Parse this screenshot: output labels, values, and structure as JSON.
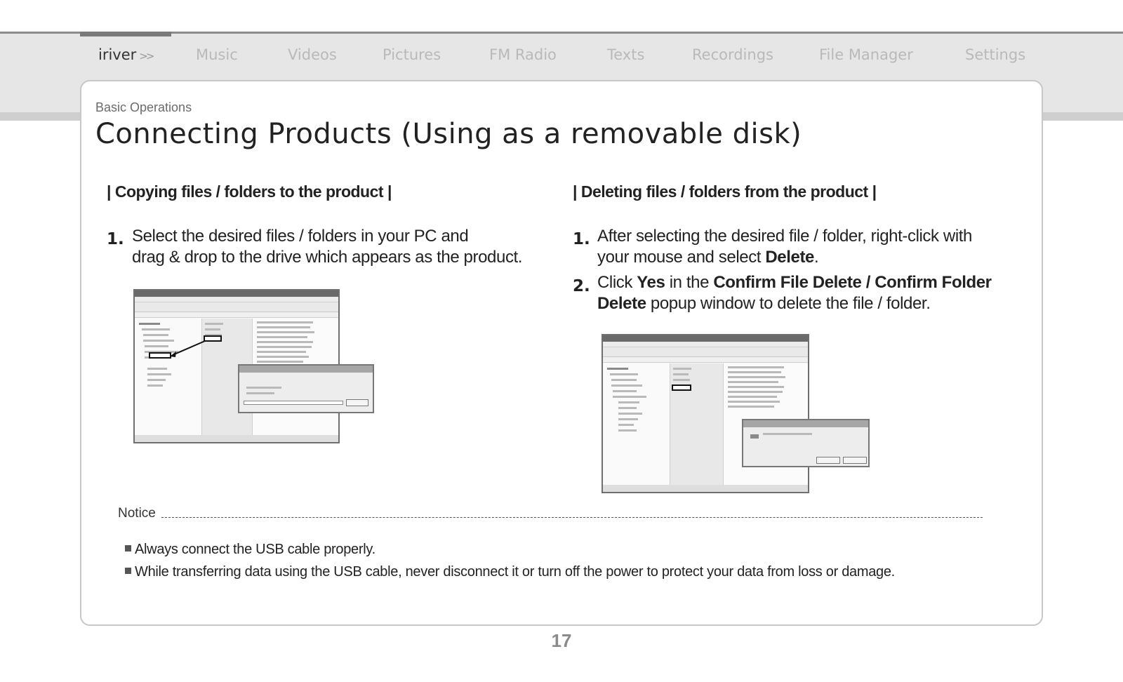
{
  "nav": {
    "brand": "iriver",
    "items": [
      "Music",
      "Videos",
      "Pictures",
      "FM Radio",
      "Texts",
      "Recordings",
      "File Manager",
      "Settings"
    ]
  },
  "breadcrumb": "Basic Operations",
  "title": "Connecting Products (Using as a removable disk)",
  "copy_section": {
    "heading": "Copying files / folders to the product",
    "steps": [
      {
        "num": "1.",
        "lines": [
          "Select the desired files / folders in your PC and",
          "drag & drop to the drive which appears as the product."
        ]
      }
    ]
  },
  "delete_section": {
    "heading": "Deleting files / folders from the product",
    "step1": {
      "num": "1.",
      "line1": "After selecting the desired file / folder, right-click with",
      "line2_prefix": "your mouse and select ",
      "line2_bold": "Delete",
      "line2_suffix": "."
    },
    "step2": {
      "num": "2.",
      "prefix": "Click ",
      "bold_yes": "Yes",
      "mid": " in the ",
      "bold_confirm": "Confirm File Delete / Confirm Folder",
      "bold_delete": "Delete",
      "suffix": " popup window to delete the file / folder."
    }
  },
  "notice": {
    "label": "Notice",
    "items": [
      "Always connect the USB cable properly.",
      "While transferring data using the USB cable, never disconnect it or turn off the power to protect your data from loss or damage."
    ]
  },
  "page_number": "17"
}
